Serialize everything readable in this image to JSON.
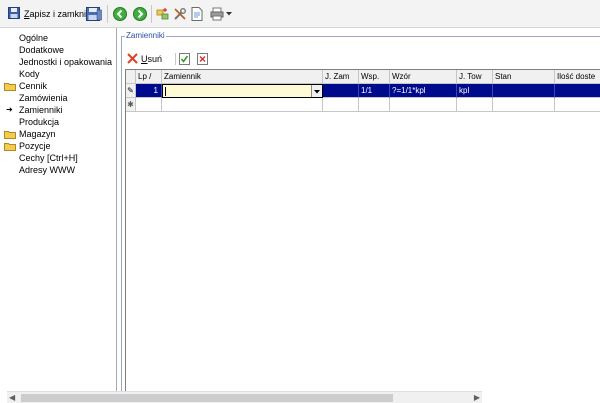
{
  "toolbar": {
    "save_close_prefix": "Z",
    "save_close_rest": "apisz i zamknij",
    "icons": [
      "save-icon",
      "floppy-icon",
      "back-icon",
      "forward-icon",
      "add-related-icon",
      "tools-icon",
      "document-icon",
      "print-icon",
      "dropdown-arrow-icon"
    ]
  },
  "nav": {
    "items": [
      {
        "label": "Ogólne",
        "folder": false,
        "current": false
      },
      {
        "label": "Dodatkowe",
        "folder": false,
        "current": false
      },
      {
        "label": "Jednostki i opakowania",
        "folder": false,
        "current": false
      },
      {
        "label": "Kody",
        "folder": false,
        "current": false
      },
      {
        "label": "Cennik",
        "folder": true,
        "current": false
      },
      {
        "label": "Zamówienia",
        "folder": false,
        "current": false
      },
      {
        "label": "Zamienniki",
        "folder": false,
        "current": true
      },
      {
        "label": "Produkcja",
        "folder": false,
        "current": false
      },
      {
        "label": "Magazyn",
        "folder": true,
        "current": false
      },
      {
        "label": "Pozycje",
        "folder": true,
        "current": false
      },
      {
        "label": "Cechy [Ctrl+H]",
        "folder": false,
        "current": false
      },
      {
        "label": "Adresy WWW",
        "folder": false,
        "current": false
      }
    ]
  },
  "panel": {
    "title": "Zamienniki",
    "delete_prefix": "U",
    "delete_rest": "suń"
  },
  "grid": {
    "columns": [
      "Lp /",
      "Zamiennik",
      "J. Zam",
      "Wsp.",
      "Wzór",
      "J. Tow",
      "Stan",
      "Ilość doste"
    ],
    "rows": [
      {
        "lp": "1",
        "zamiennik": "",
        "jzam": "",
        "wsp": "1/1",
        "wzor": "?=1/1*kpl",
        "jtow": "kpl",
        "stan": "",
        "ilosc": ""
      }
    ],
    "editing_indicator": "✎",
    "new_row_indicator": "✱"
  },
  "colors": {
    "selection": "#000a8c",
    "editor_bg": "#fffbd6",
    "folder": "#f2cc4a",
    "group_title": "#2b4da0"
  }
}
